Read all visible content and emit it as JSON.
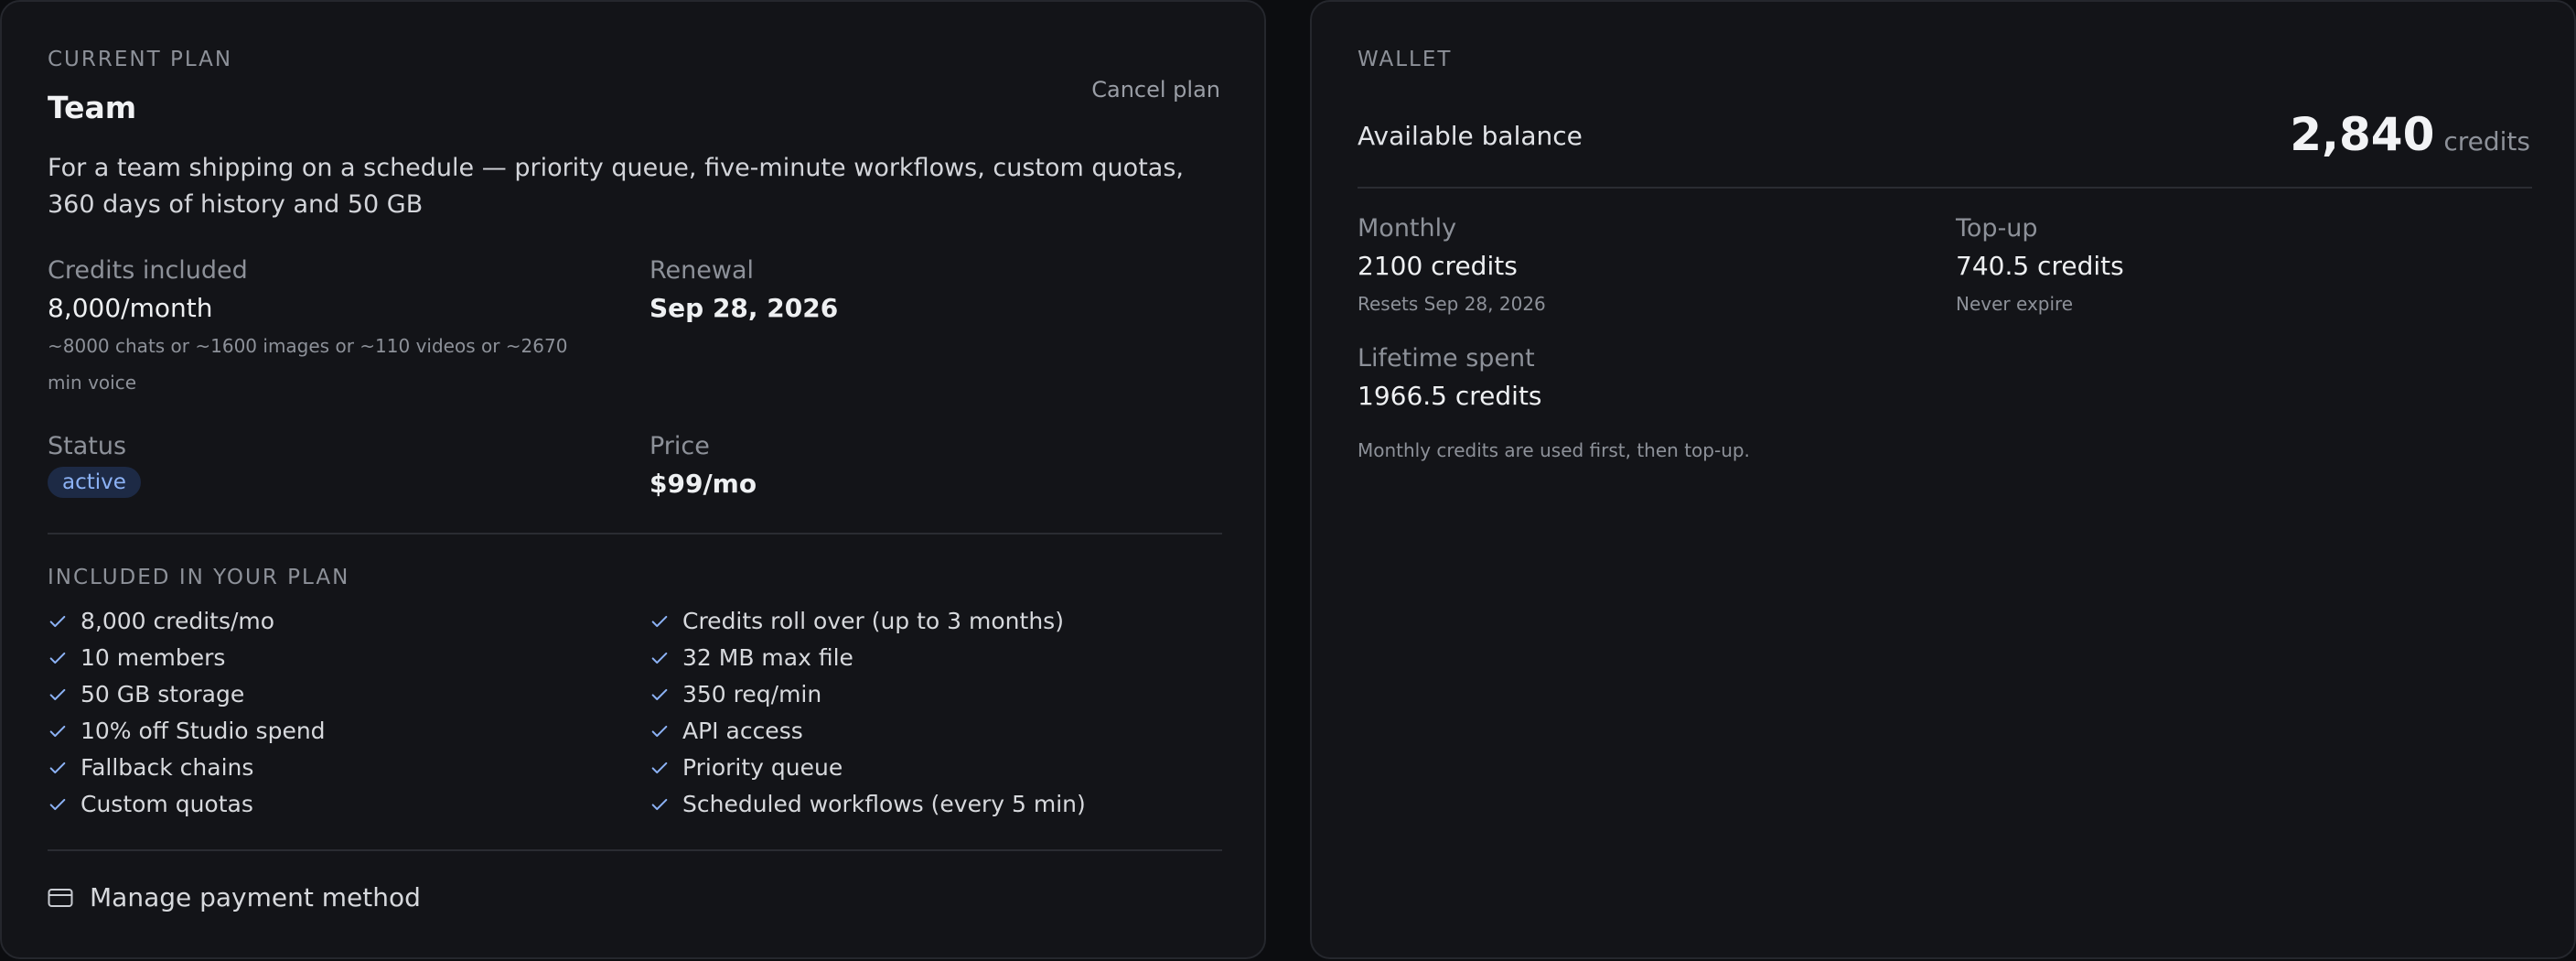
{
  "plan": {
    "eyebrow": "CURRENT PLAN",
    "name": "Team",
    "cancel_label": "Cancel plan",
    "description": "For a team shipping on a schedule — priority queue, five-minute workflows, custom quotas, 360 days of history and 50 GB",
    "credits_label": "Credits included",
    "credits_value": "8,000/month",
    "credits_note": "~8000 chats or ~1600 images or ~110 videos or ~2670 min voice",
    "renewal_label": "Renewal",
    "renewal_value": "Sep 28, 2026",
    "status_label": "Status",
    "status_value": "active",
    "price_label": "Price",
    "price_value": "$99/mo",
    "included_heading": "INCLUDED IN YOUR PLAN",
    "features_left": [
      "8,000 credits/mo",
      "10 members",
      "50 GB storage",
      "10% off Studio spend",
      "Fallback chains",
      "Custom quotas"
    ],
    "features_right": [
      "Credits roll over (up to 3 months)",
      "32 MB max file",
      "350 req/min",
      "API access",
      "Priority queue",
      "Scheduled workflows (every 5 min)"
    ],
    "payment_label": "Manage payment method"
  },
  "wallet": {
    "eyebrow": "WALLET",
    "balance_label": "Available balance",
    "balance_value": "2,840",
    "balance_unit": "credits",
    "monthly_label": "Monthly",
    "monthly_value": "2100 credits",
    "monthly_note": "Resets Sep 28, 2026",
    "topup_label": "Top-up",
    "topup_value": "740.5 credits",
    "topup_note": "Never expire",
    "lifetime_label": "Lifetime spent",
    "lifetime_value": "1966.5 credits",
    "footnote": "Monthly credits are used first, then top-up."
  },
  "colors": {
    "background": "#0c0d10",
    "card": "#131418",
    "accent": "#8cb2f5",
    "badge_bg": "#1d2a45"
  },
  "icons": {
    "check": "check-icon",
    "payment": "credit-card-icon"
  }
}
